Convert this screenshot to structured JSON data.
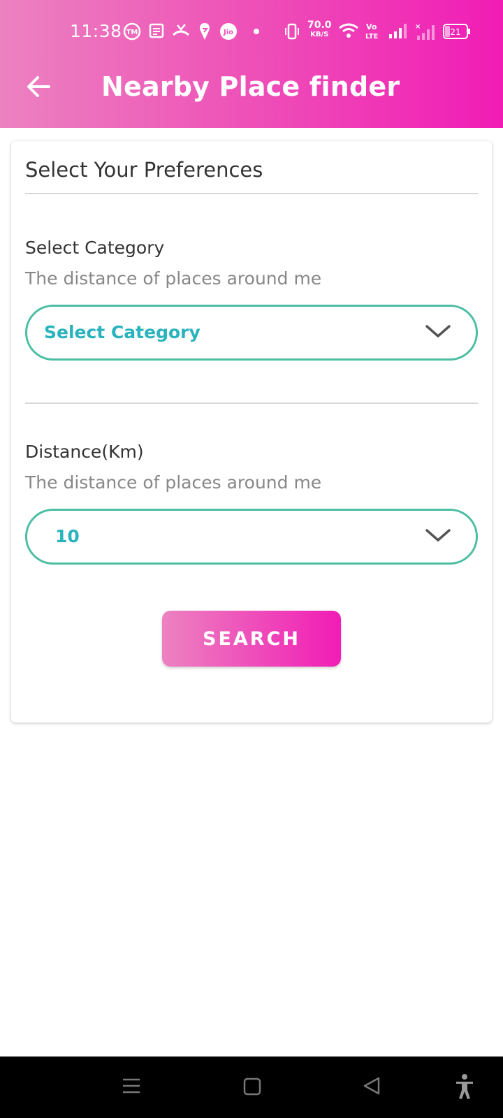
{
  "status_bar": {
    "time": "11:38",
    "net_speed_value": "70.0",
    "net_speed_unit": "KB/S",
    "battery_level": "21",
    "jio_label": "Jio",
    "tm_label": "TM",
    "volte_label": "Vo LTE",
    "icons": [
      "truemessenger-icon",
      "news-icon",
      "missed-call-icon",
      "swiggy-icon",
      "jio-icon",
      "dot-icon",
      "vibrate-icon",
      "wifi-icon",
      "volte-icon",
      "signal-icon",
      "signal-no-service-icon",
      "battery-icon"
    ]
  },
  "appbar": {
    "back_icon": "arrow-left-icon",
    "title": "Nearby Place finder"
  },
  "card": {
    "title": "Select Your Preferences",
    "category": {
      "label": "Select Category",
      "hint": "The distance of places around me",
      "selected": "Select Category"
    },
    "distance": {
      "label": "Distance(Km)",
      "hint": "The distance of places around me",
      "selected": "10"
    },
    "search_button": "SEARCH"
  },
  "nav_bar": {
    "icons": [
      "menu-icon",
      "home-square-icon",
      "back-triangle-icon",
      "accessibility-icon"
    ]
  },
  "colors": {
    "gradient_start": "#ec82c0",
    "gradient_end": "#f11cb5",
    "select_border": "#4cbea3",
    "select_text": "#29b3bd"
  }
}
